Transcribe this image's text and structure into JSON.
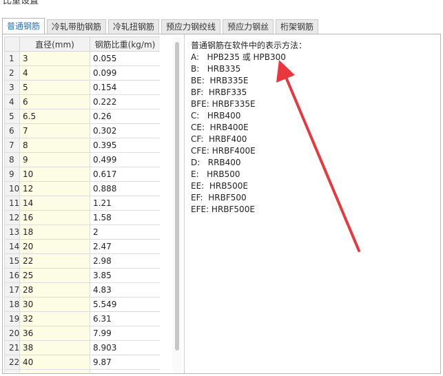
{
  "window": {
    "title": "比重设置"
  },
  "tabs": [
    {
      "label": "普通钢筋",
      "active": true
    },
    {
      "label": "冷轧带肋钢筋",
      "active": false
    },
    {
      "label": "冷轧扭钢筋",
      "active": false
    },
    {
      "label": "预应力钢绞线",
      "active": false
    },
    {
      "label": "预应力钢丝",
      "active": false
    },
    {
      "label": "桁架钢筋",
      "active": false
    }
  ],
  "table": {
    "columns": [
      "直径(mm)",
      "钢筋比重(kg/m)"
    ],
    "rows": [
      {
        "no": "1",
        "diameter": "3",
        "weight": "0.055"
      },
      {
        "no": "2",
        "diameter": "4",
        "weight": "0.099"
      },
      {
        "no": "3",
        "diameter": "5",
        "weight": "0.154"
      },
      {
        "no": "4",
        "diameter": "6",
        "weight": "0.222"
      },
      {
        "no": "5",
        "diameter": "6.5",
        "weight": "0.26"
      },
      {
        "no": "6",
        "diameter": "7",
        "weight": "0.302"
      },
      {
        "no": "7",
        "diameter": "8",
        "weight": "0.395"
      },
      {
        "no": "8",
        "diameter": "9",
        "weight": "0.499"
      },
      {
        "no": "9",
        "diameter": "10",
        "weight": "0.617"
      },
      {
        "no": "10",
        "diameter": "12",
        "weight": "0.888"
      },
      {
        "no": "11",
        "diameter": "14",
        "weight": "1.21"
      },
      {
        "no": "12",
        "diameter": "16",
        "weight": "1.58"
      },
      {
        "no": "13",
        "diameter": "18",
        "weight": "2"
      },
      {
        "no": "14",
        "diameter": "20",
        "weight": "2.47"
      },
      {
        "no": "15",
        "diameter": "22",
        "weight": "2.98"
      },
      {
        "no": "16",
        "diameter": "25",
        "weight": "3.85"
      },
      {
        "no": "17",
        "diameter": "28",
        "weight": "4.83"
      },
      {
        "no": "18",
        "diameter": "30",
        "weight": "5.549"
      },
      {
        "no": "19",
        "diameter": "32",
        "weight": "6.31"
      },
      {
        "no": "20",
        "diameter": "36",
        "weight": "7.99"
      },
      {
        "no": "21",
        "diameter": "38",
        "weight": "8.903"
      },
      {
        "no": "22",
        "diameter": "40",
        "weight": "9.87"
      },
      {
        "no": "",
        "diameter": "",
        "weight": ""
      }
    ]
  },
  "info": {
    "heading": "普通钢筋在软件中的表示方法：",
    "lines": [
      "A:   HPB235 或 HPB300",
      "B:   HRB335",
      "BE:  HRB335E",
      "BF:  HRBF335",
      "BFE: HRBF335E",
      "C:   HRB400",
      "CE:  HRB400E",
      "CF:  HRBF400",
      "CFE: HRBF400E",
      "D:   RRB400",
      "E:   HRB500",
      "EE:  HRB500E",
      "EF:  HRBF500",
      "EFE: HRBF500E"
    ]
  },
  "colors": {
    "active_tab_text": "#2a72c8",
    "diameter_cell_bg": "#fdfce4",
    "annotation_arrow": "#e8383d"
  },
  "annotation": {
    "icon": "red-arrow-icon",
    "points_to": "HPB235 或 HPB300"
  }
}
